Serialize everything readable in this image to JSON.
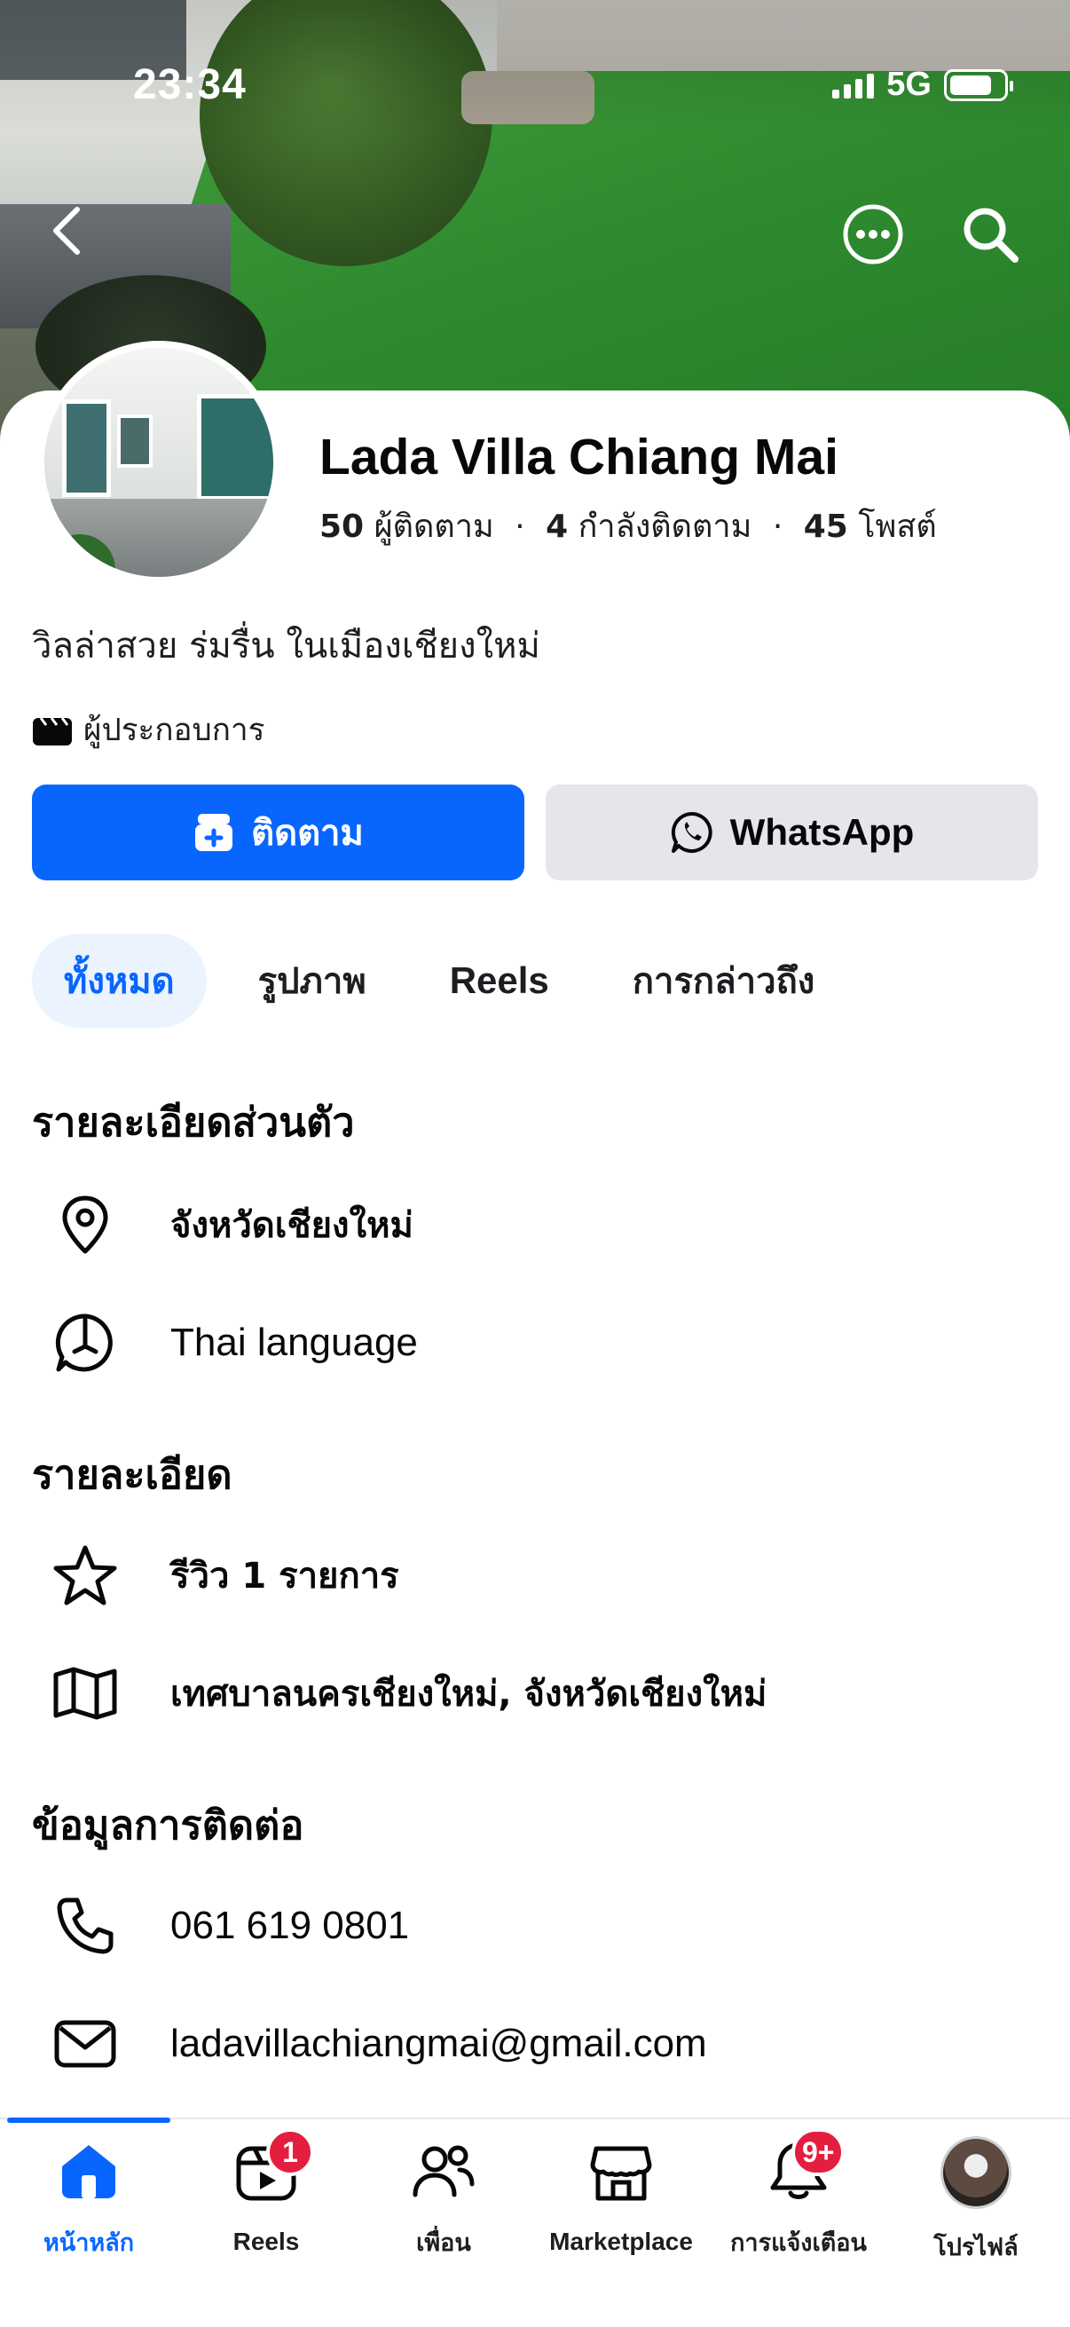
{
  "status_bar": {
    "time": "23:34",
    "network": "5G",
    "battery_percent": 80
  },
  "cover": {
    "description_icon": "cover-photo"
  },
  "profile": {
    "name": "Lada Villa Chiang Mai",
    "followers_count": "50",
    "followers_label": "ผู้ติดตาม",
    "following_count": "4",
    "following_label": "กำลังติดตาม",
    "posts_count": "45",
    "posts_label": "โพสต์",
    "bio": "วิลล่าสวย ร่มรื่น ในเมืองเชียงใหม่",
    "category": "ผู้ประกอบการ"
  },
  "actions": {
    "follow_label": "ติดตาม",
    "whatsapp_label": "WhatsApp"
  },
  "tabs": [
    {
      "label": "ทั้งหมด",
      "active": true
    },
    {
      "label": "รูปภาพ",
      "active": false
    },
    {
      "label": "Reels",
      "active": false
    },
    {
      "label": "การกล่าวถึง",
      "active": false
    }
  ],
  "sections": {
    "personal": {
      "title": "รายละเอียดส่วนตัว",
      "location": "จังหวัดเชียงใหม่",
      "language": "Thai language"
    },
    "details": {
      "title": "รายละเอียด",
      "reviews": "รีวิว 1 รายการ",
      "address": "เทศบาลนครเชียงใหม่, จังหวัดเชียงใหม่"
    },
    "contact": {
      "title": "ข้อมูลการติดต่อ",
      "phone": "061 619 0801",
      "email": "ladavillachiangmai@gmail.com"
    }
  },
  "bottom_nav": {
    "home": "หน้าหลัก",
    "reels": "Reels",
    "reels_badge": "1",
    "friends": "เพื่อน",
    "marketplace": "Marketplace",
    "notifications": "การแจ้งเตือน",
    "notifications_badge": "9+",
    "profile": "โปรไฟล์"
  },
  "colors": {
    "accent": "#0866ff",
    "badge": "#e41e3f",
    "secondary_button": "#e4e6eb",
    "active_tab_bg": "#ebf3ff"
  }
}
